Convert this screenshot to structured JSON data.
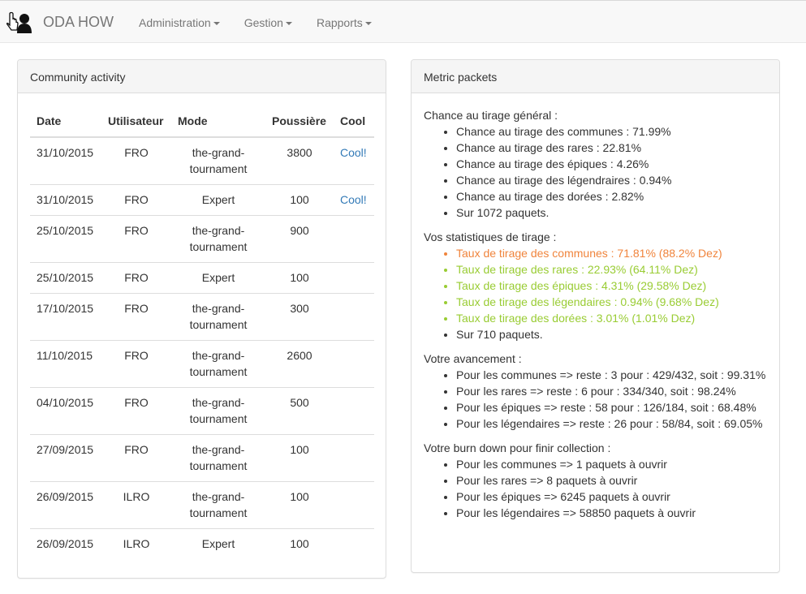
{
  "navbar": {
    "brand": "ODA HOW",
    "logo_icon": "hand-user-logo-icon",
    "menu": [
      {
        "label": "Administration"
      },
      {
        "label": "Gestion"
      },
      {
        "label": "Rapports"
      }
    ]
  },
  "community": {
    "title": "Community activity",
    "headers": [
      "Date",
      "Utilisateur",
      "Mode",
      "Poussière",
      "Cool"
    ],
    "rows": [
      {
        "date": "31/10/2015",
        "user": "FRO",
        "mode": "the-grand-tournament",
        "dust": "3800",
        "cool": "Cool!"
      },
      {
        "date": "31/10/2015",
        "user": "FRO",
        "mode": "Expert",
        "dust": "100",
        "cool": "Cool!"
      },
      {
        "date": "25/10/2015",
        "user": "FRO",
        "mode": "the-grand-tournament",
        "dust": "900",
        "cool": ""
      },
      {
        "date": "25/10/2015",
        "user": "FRO",
        "mode": "Expert",
        "dust": "100",
        "cool": ""
      },
      {
        "date": "17/10/2015",
        "user": "FRO",
        "mode": "the-grand-tournament",
        "dust": "300",
        "cool": ""
      },
      {
        "date": "11/10/2015",
        "user": "FRO",
        "mode": "the-grand-tournament",
        "dust": "2600",
        "cool": ""
      },
      {
        "date": "04/10/2015",
        "user": "FRO",
        "mode": "the-grand-tournament",
        "dust": "500",
        "cool": ""
      },
      {
        "date": "27/09/2015",
        "user": "FRO",
        "mode": "the-grand-tournament",
        "dust": "100",
        "cool": ""
      },
      {
        "date": "26/09/2015",
        "user": "ILRO",
        "mode": "the-grand-tournament",
        "dust": "100",
        "cool": ""
      },
      {
        "date": "26/09/2015",
        "user": "ILRO",
        "mode": "Expert",
        "dust": "100",
        "cool": ""
      }
    ]
  },
  "metrics": {
    "title": "Metric packets",
    "colors": {
      "orange": "#f0843c",
      "green": "#99cc33"
    },
    "sections": [
      {
        "heading": "Chance au tirage général :",
        "items": [
          {
            "text": "Chance au tirage des communes : 71.99%",
            "color": ""
          },
          {
            "text": "Chance au tirage des rares : 22.81%",
            "color": ""
          },
          {
            "text": "Chance au tirage des épiques : 4.26%",
            "color": ""
          },
          {
            "text": "Chance au tirage des légendraires : 0.94%",
            "color": ""
          },
          {
            "text": "Chance au tirage des dorées : 2.82%",
            "color": ""
          },
          {
            "text": "Sur 1072 paquets.",
            "color": ""
          }
        ]
      },
      {
        "heading": "Vos statistiques de tirage :",
        "items": [
          {
            "text": "Taux de tirage des communes : 71.81% (88.2% Dez)",
            "color": "orange"
          },
          {
            "text": "Taux de tirage des rares : 22.93% (64.11% Dez)",
            "color": "green"
          },
          {
            "text": "Taux de tirage des épiques : 4.31% (29.58% Dez)",
            "color": "green"
          },
          {
            "text": "Taux de tirage des légendaires : 0.94% (9.68% Dez)",
            "color": "green"
          },
          {
            "text": "Taux de tirage des dorées : 3.01% (1.01% Dez)",
            "color": "green"
          },
          {
            "text": "Sur 710 paquets.",
            "color": ""
          }
        ]
      },
      {
        "heading": "Votre avancement :",
        "items": [
          {
            "text": "Pour les communes => reste : 3 pour : 429/432, soit : 99.31%",
            "color": ""
          },
          {
            "text": "Pour les rares => reste : 6 pour : 334/340, soit : 98.24%",
            "color": ""
          },
          {
            "text": "Pour les épiques => reste : 58 pour : 126/184, soit : 68.48%",
            "color": ""
          },
          {
            "text": "Pour les légendaires => reste : 26 pour : 58/84, soit : 69.05%",
            "color": ""
          }
        ]
      },
      {
        "heading": "Votre burn down pour finir collection :",
        "items": [
          {
            "text": "Pour les communes => 1 paquets à ouvrir",
            "color": ""
          },
          {
            "text": "Pour les rares => 8 paquets à ouvrir",
            "color": ""
          },
          {
            "text": "Pour les épiques => 6245 paquets à ouvrir",
            "color": ""
          },
          {
            "text": "Pour les légendaires => 58850 paquets à ouvrir",
            "color": ""
          }
        ]
      }
    ]
  }
}
